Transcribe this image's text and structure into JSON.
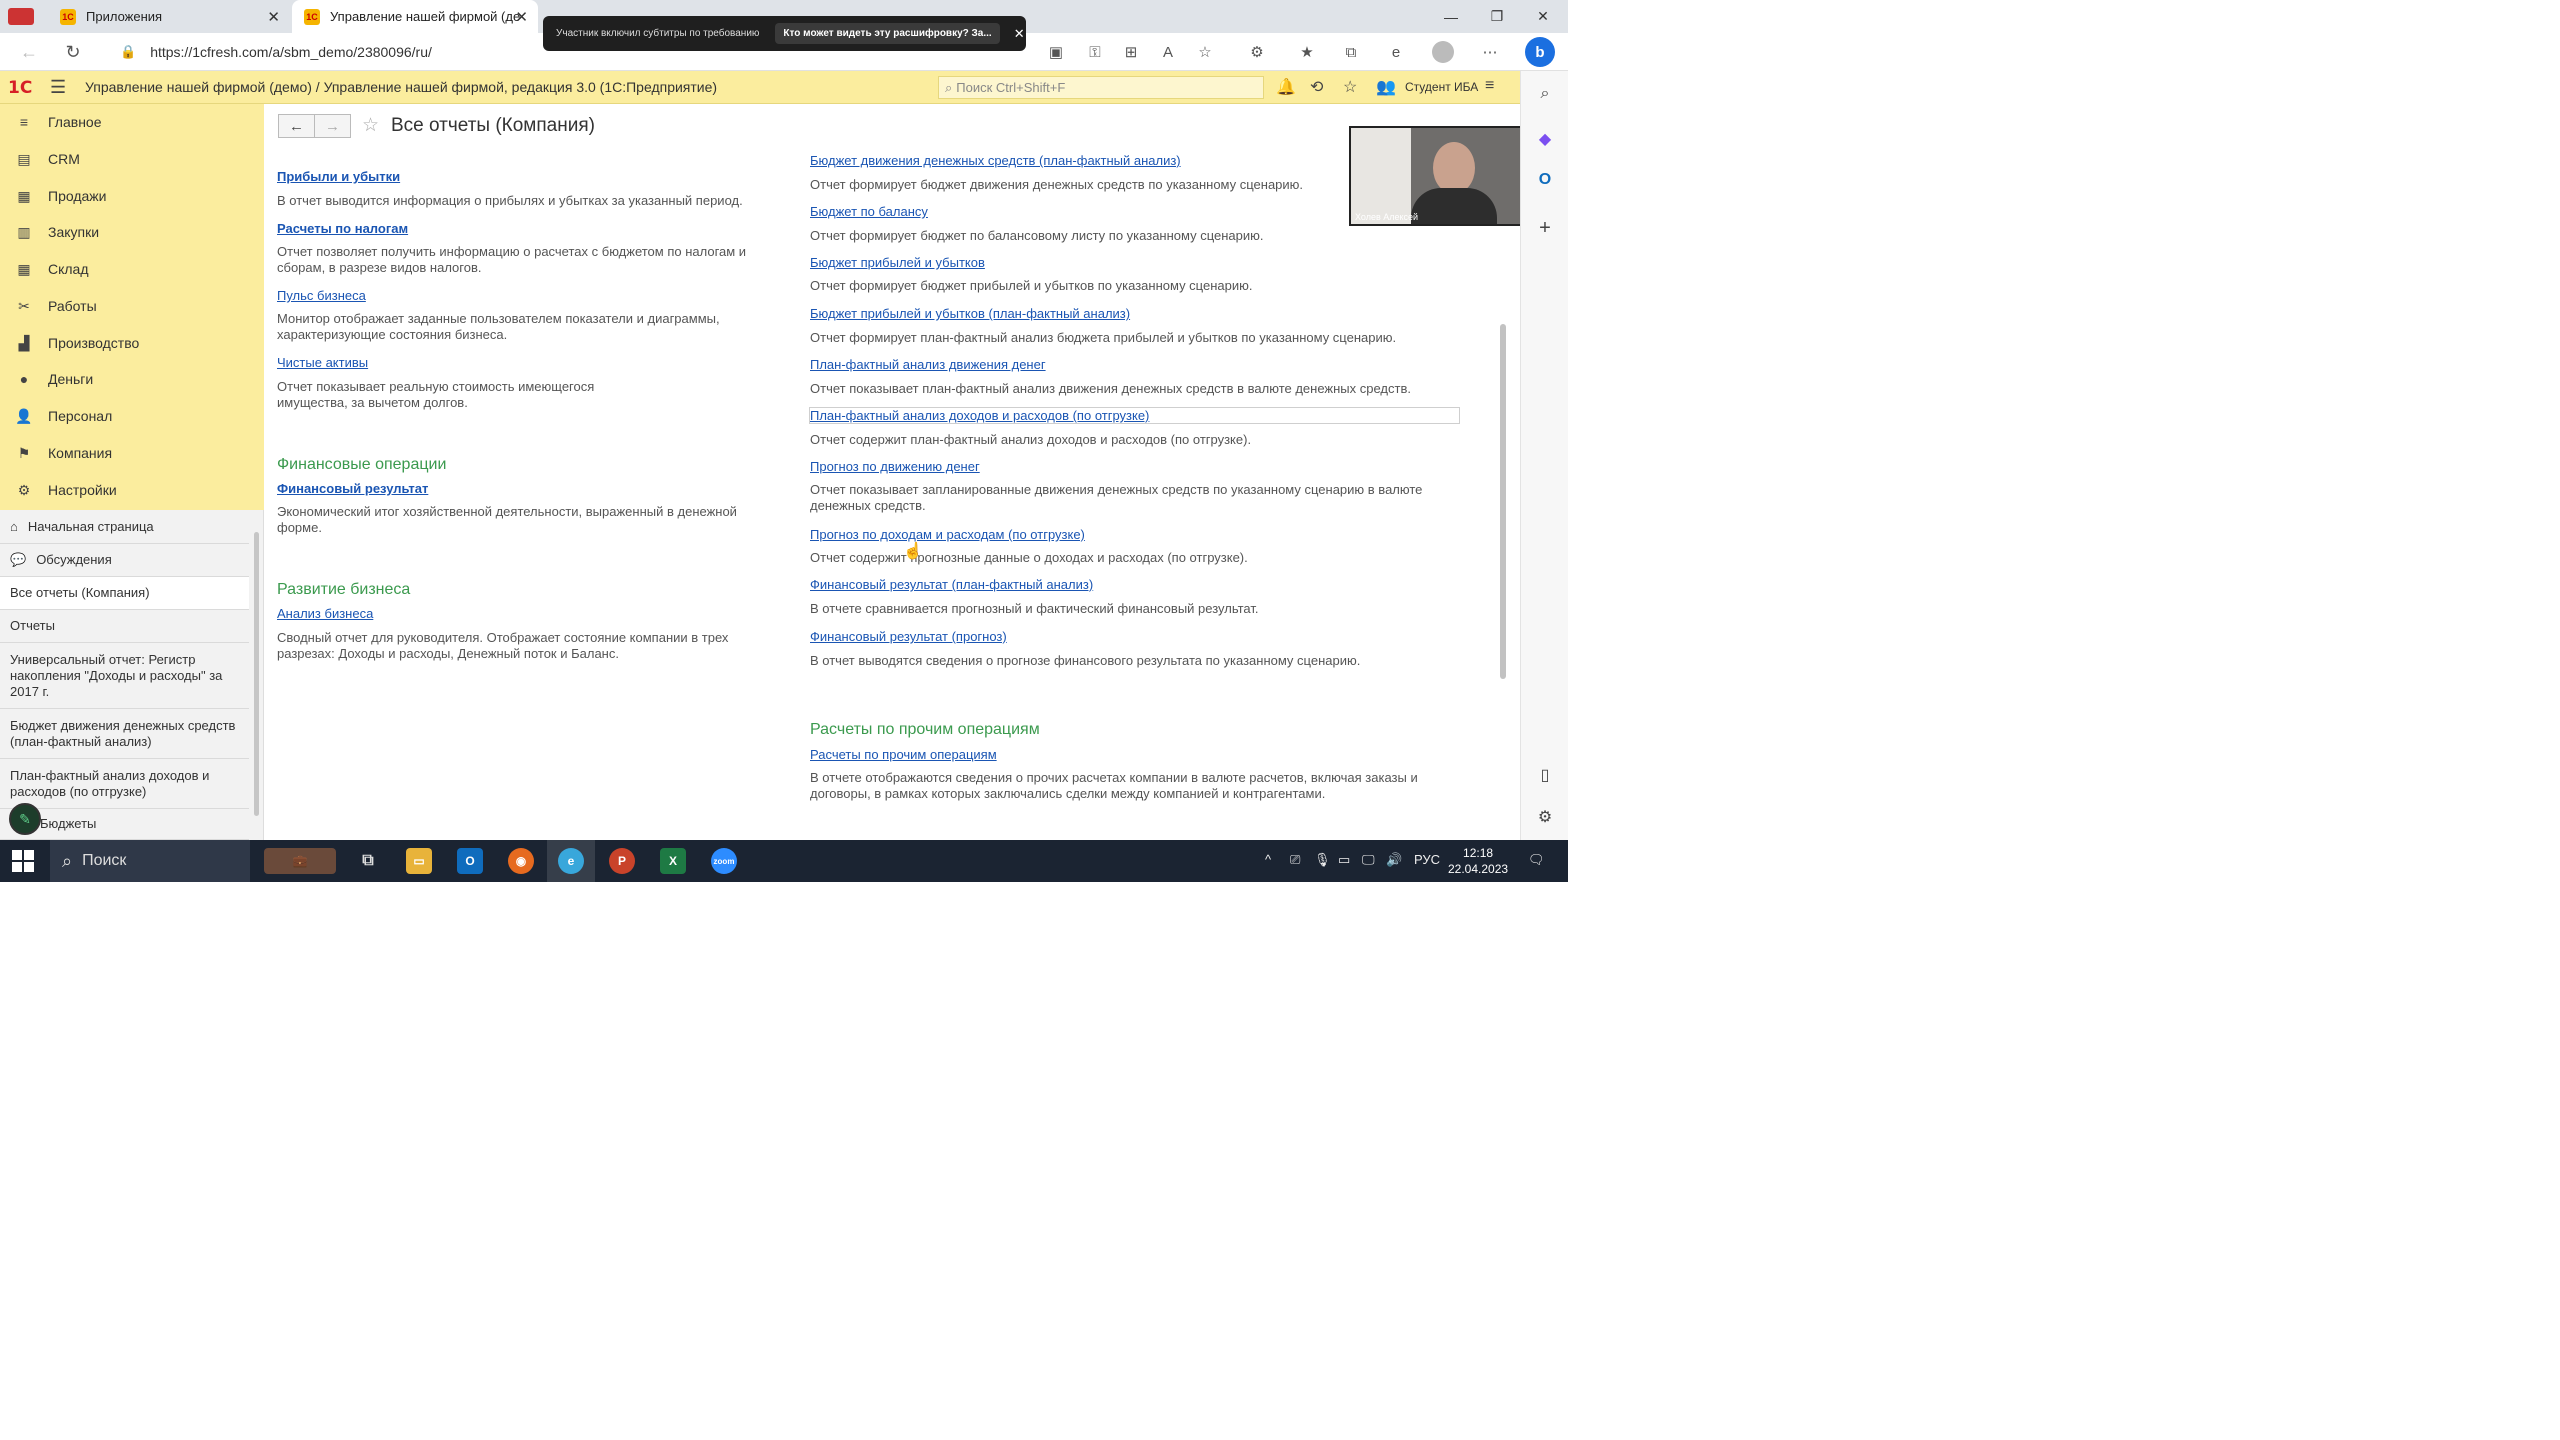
{
  "browser": {
    "tabs": [
      {
        "label": "Приложения",
        "icon": "1c-icon"
      },
      {
        "label": "Управление нашей фирмой (де",
        "icon": "1c-icon"
      }
    ],
    "url": "https://1cfresh.com/a/sbm_demo/2380096/ru/"
  },
  "caption_popup": {
    "notice": "Участник включил субтитры по требованию",
    "question": "Кто может видеть эту расшифровку? За..."
  },
  "app": {
    "logo": "1С",
    "title": "Управление нашей фирмой (демо) / Управление нашей фирмой, редакция 3.0  (1С:Предприятие)",
    "search_placeholder": "Поиск Ctrl+Shift+F",
    "user": "Студент ИБА"
  },
  "sidebar": {
    "items": [
      {
        "label": "Главное",
        "icon": "menu-lines-icon"
      },
      {
        "label": "CRM",
        "icon": "crm-icon"
      },
      {
        "label": "Продажи",
        "icon": "sales-icon"
      },
      {
        "label": "Закупки",
        "icon": "purchases-icon"
      },
      {
        "label": "Склад",
        "icon": "warehouse-icon"
      },
      {
        "label": "Работы",
        "icon": "tools-icon"
      },
      {
        "label": "Производство",
        "icon": "production-icon"
      },
      {
        "label": "Деньги",
        "icon": "money-icon"
      },
      {
        "label": "Персонал",
        "icon": "personnel-icon"
      },
      {
        "label": "Компания",
        "icon": "flag-icon"
      },
      {
        "label": "Настройки",
        "icon": "gear-icon"
      }
    ]
  },
  "open_windows": {
    "items": [
      {
        "label": "Начальная страница"
      },
      {
        "label": "Обсуждения"
      },
      {
        "label": "Все отчеты (Компания)"
      },
      {
        "label": "Отчеты"
      },
      {
        "label": "Универсальный отчет: Регистр накопления \"Доходы и расходы\" за 2017 г."
      },
      {
        "label": "Бюджет движения денежных средств (план-фактный анализ)"
      },
      {
        "label": "План-фактный анализ доходов и расходов (по отгрузке)"
      },
      {
        "label": "Бюджеты"
      }
    ]
  },
  "form": {
    "title": "Все отчеты (Компания)"
  },
  "left_column": {
    "reports": [
      {
        "title": "Прибыли и убытки",
        "desc": "В отчет выводится информация о прибылях и убытках за указанный период."
      },
      {
        "title": "Расчеты по налогам",
        "desc": "Отчет позволяет получить информацию о расчетах с бюджетом по налогам и сборам, в разрезе видов налогов."
      },
      {
        "title": "Пульс бизнеса",
        "desc": "Монитор отображает заданные пользователем показатели и диаграммы, характеризующие состояния бизнеса."
      },
      {
        "title": "Чистые активы",
        "desc": "Отчет показывает реальную стоимость имеющегося имущества, за вычетом долгов."
      }
    ],
    "groups": [
      {
        "title": "Финансовые операции",
        "report": "Финансовый результат",
        "desc": "Экономический итог хозяйственной деятельности, выраженный в денежной форме."
      },
      {
        "title": "Развитие бизнеса",
        "report": "Анализ бизнеса",
        "desc": "Сводный отчет для руководителя. Отображает состояние компании в трех разрезах: Доходы и расходы, Денежный поток и Баланс."
      }
    ]
  },
  "right_column": {
    "reports": [
      {
        "title": "Бюджет движения денежных средств (план-фактный анализ)",
        "desc": "Отчет формирует бюджет движения денежных средств по указанному сценарию."
      },
      {
        "title": "Бюджет по балансу",
        "desc": "Отчет формирует бюджет по балансовому листу по указанному сценарию."
      },
      {
        "title": "Бюджет прибылей и убытков",
        "desc": "Отчет формирует бюджет прибылей и убытков по указанному сценарию."
      },
      {
        "title": "Бюджет прибылей и убытков (план-фактный анализ)",
        "desc": "Отчет формирует план-фактный анализ бюджета прибылей и убытков по указанному сценарию."
      },
      {
        "title": "План-фактный анализ движения денег",
        "desc": "Отчет показывает план-фактный анализ движения денежных средств в валюте денежных средств."
      },
      {
        "title": "План-фактный анализ доходов и расходов (по отгрузке)",
        "desc": "Отчет содержит план-фактный анализ доходов и расходов (по отгрузке)."
      },
      {
        "title": "Прогноз по движению денег",
        "desc": "Отчет показывает запланированные движения денежных средств по указанному сценарию в валюте денежных средств."
      },
      {
        "title": "Прогноз по доходам и расходам (по отгрузке)",
        "desc": "Отчет содержит прогнозные данные о доходах и расходах (по отгрузке)."
      },
      {
        "title": "Финансовый результат (план-фактный анализ)",
        "desc": "В отчете сравнивается прогнозный и фактический финансовый результат."
      },
      {
        "title": "Финансовый результат (прогноз)",
        "desc": "В отчет выводятся сведения о прогнозе финансового результата по указанному сценарию."
      }
    ],
    "group": {
      "title": "Расчеты по прочим операциям",
      "report": "Расчеты по прочим операциям",
      "desc": "В отчете отображаются сведения о прочих расчетах компании в валюте расчетов, включая заказы и договоры, в рамках которых заключались сделки между компанией и контрагентами."
    }
  },
  "video": {
    "participant": "Холев Алексей"
  },
  "taskbar": {
    "search_label": "Поиск",
    "language": "РУС",
    "time": "12:18",
    "date": "22.04.2023"
  }
}
